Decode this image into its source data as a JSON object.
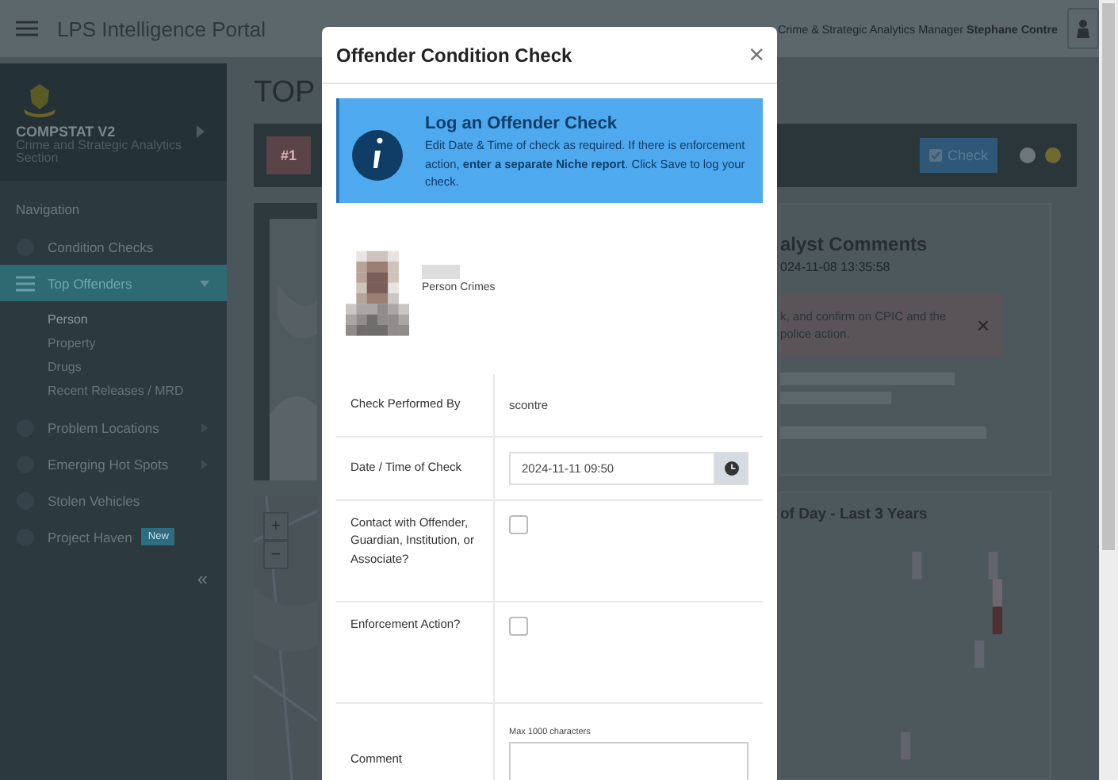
{
  "topbar": {
    "title": "LPS Intelligence Portal",
    "user": "Crime & Strategic Analytics Manager **Stephane Contre**"
  },
  "sidebar": {
    "app": "COMPSTAT V2",
    "section": "Crime and Strategic Analytics Section",
    "heading": "Navigation",
    "collapse": "«",
    "items": [
      {
        "kind": "link",
        "label": "Condition Checks",
        "selected": false
      },
      {
        "kind": "group",
        "label": "Top Offenders",
        "selected": true,
        "expanded": true,
        "children": [
          {
            "label": "Person",
            "selected": true
          },
          {
            "label": "Property",
            "selected": false
          },
          {
            "label": "Drugs",
            "selected": false
          },
          {
            "label": "Recent Releases / MRD",
            "selected": false
          }
        ]
      },
      {
        "kind": "group",
        "label": "Problem Locations",
        "selected": false,
        "expanded": false
      },
      {
        "kind": "group",
        "label": "Emerging Hot Spots",
        "selected": false,
        "expanded": false
      },
      {
        "kind": "link",
        "label": "Stolen Vehicles",
        "selected": false
      },
      {
        "kind": "link",
        "label": "Project Haven",
        "selected": false,
        "badge": "New"
      }
    ]
  },
  "main": {
    "page_title": "TOP",
    "rank": "#1",
    "check_button": "Check",
    "map_zoom": [
      "+",
      "−"
    ],
    "comments": {
      "title": "alyst Comments",
      "timestamp": "024-11-08 13:35:58",
      "alert": "k, and confirm on CPIC and the police action.",
      "close": "×"
    },
    "chart_title": "of Day - Last 3 Years"
  },
  "modal": {
    "title": "Offender Condition Check",
    "close": "×",
    "banner": {
      "title": "Log an Offender Check",
      "body": "Edit Date & Time of check as required. If there is enforcement action, **enter a separate Niche report**. Click Save to log your check."
    },
    "person": {
      "kind": "picture",
      "category": "Person Crimes"
    },
    "form": [
      {
        "kind": "text",
        "label": "Check Performed By",
        "value": "scontre"
      },
      {
        "kind": "datetime",
        "label": "Date / Time of Check",
        "value": "2024-11-11 09:50"
      },
      {
        "kind": "checkbox",
        "label": "Contact with Offender, Guardian, Institution, or Associate?",
        "checked": false
      },
      {
        "kind": "checkbox",
        "label": "Enforcement Action?",
        "checked": false
      },
      {
        "kind": "textarea",
        "label": "Comment",
        "hint": "Max 1000 characters"
      }
    ]
  }
}
